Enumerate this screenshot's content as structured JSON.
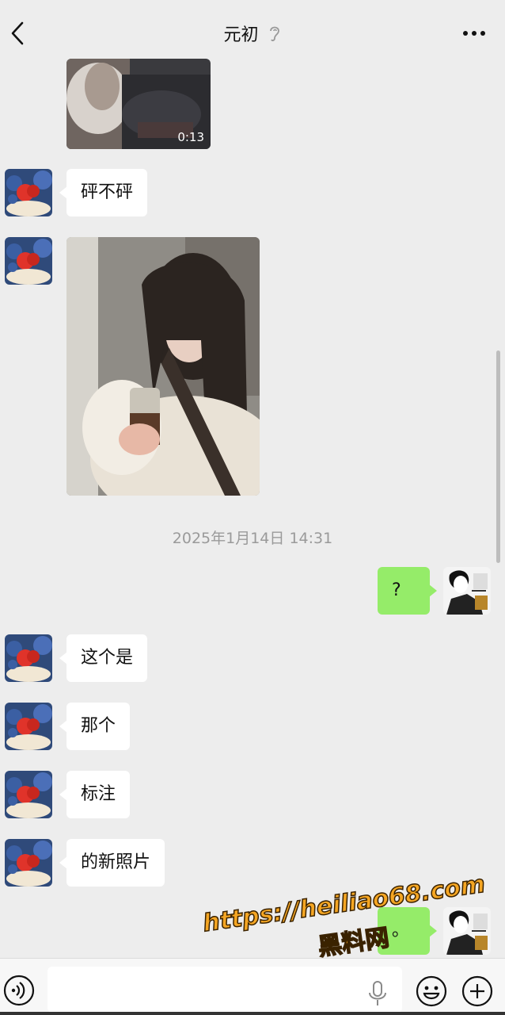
{
  "header": {
    "title": "元初",
    "back_icon": "chevron-left-icon",
    "ear_icon": "ear-icon",
    "more_icon": "more-dots-icon"
  },
  "messages": {
    "video_duration": "0:13",
    "m1": "砰不砰",
    "timestamp": "2025年1月14日 14:31",
    "m_self1": "?",
    "m2": "这个是",
    "m3": "那个",
    "m4": "标注",
    "m5": "的新照片",
    "m_self2": "。"
  },
  "inputbar": {
    "placeholder": "",
    "voice_icon": "voice-icon",
    "mic_icon": "mic-icon",
    "emoji_icon": "emoji-icon",
    "plus_icon": "plus-icon"
  },
  "watermark": {
    "url": "https://heiliao68.com",
    "name": "黑料网"
  },
  "colors": {
    "background": "#ededed",
    "self_bubble": "#95ec69",
    "other_bubble": "#ffffff",
    "watermark": "#f5a623"
  }
}
